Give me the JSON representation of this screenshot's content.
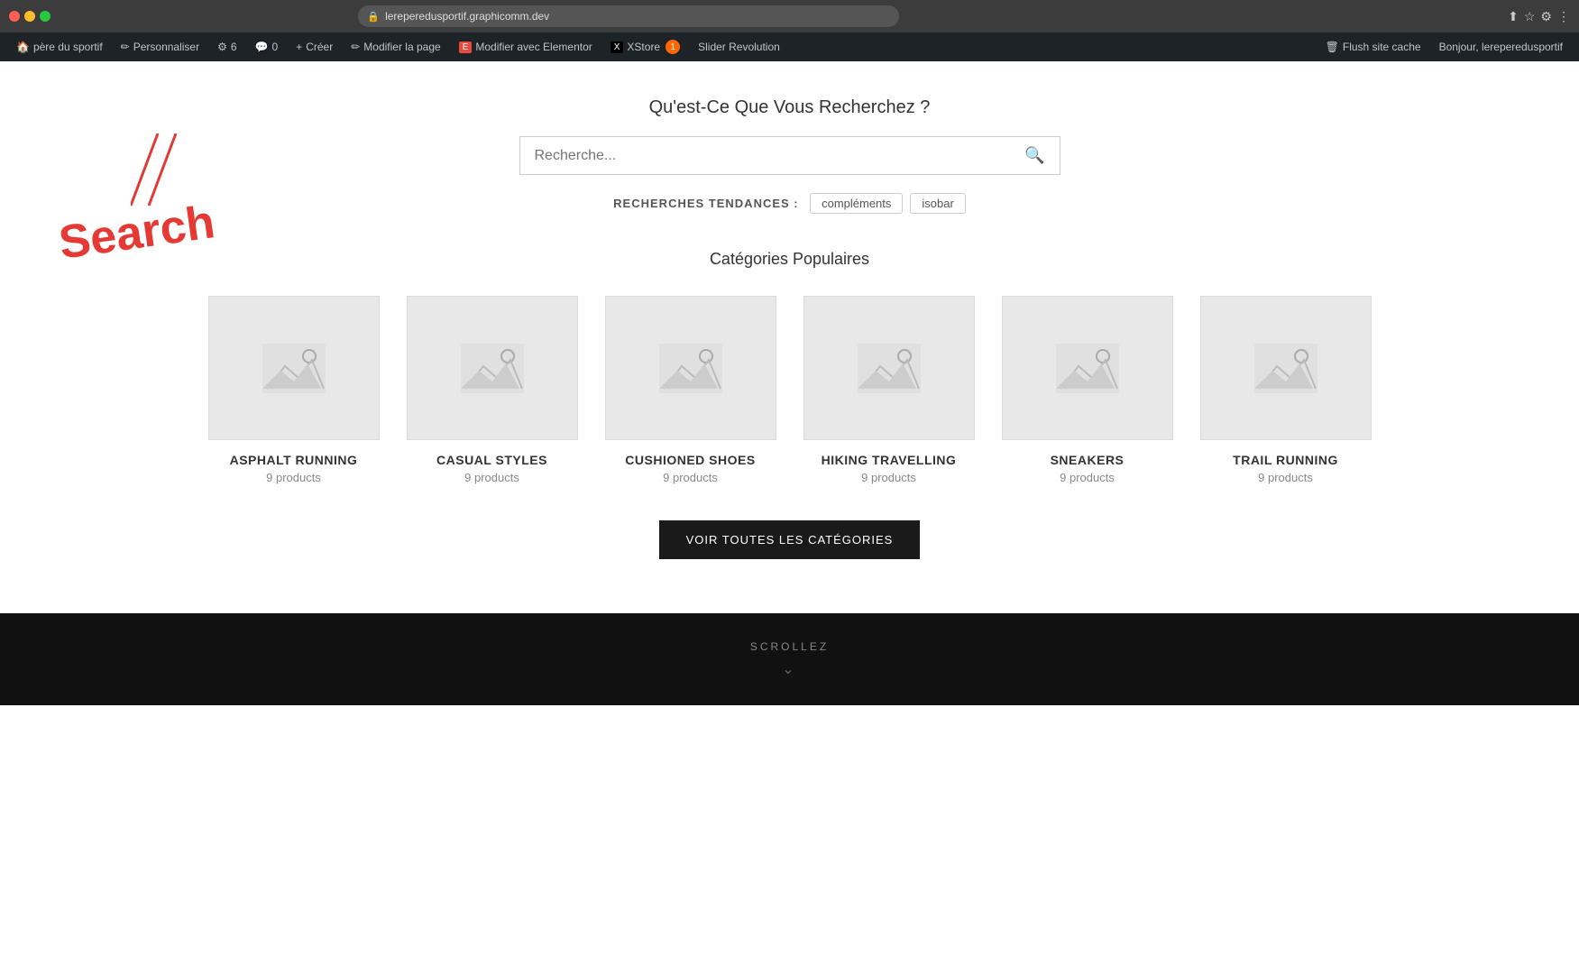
{
  "browser": {
    "url": "lereperedusportif.graphicomm.dev",
    "lock_symbol": "🔒"
  },
  "admin_bar": {
    "site_name": "père du sportif",
    "items": [
      {
        "label": "Personnaliser",
        "icon": "✏️"
      },
      {
        "label": "6",
        "icon": "⚙️"
      },
      {
        "label": "0",
        "icon": "💬"
      },
      {
        "label": "Créer",
        "icon": "+"
      },
      {
        "label": "Modifier la page",
        "icon": "✏️"
      },
      {
        "label": "Modifier avec Elementor",
        "icon": "E"
      },
      {
        "label": "XStore",
        "icon": "X",
        "badge": "1"
      },
      {
        "label": "Slider Revolution",
        "icon": ""
      }
    ],
    "flush_label": "Flush site cache",
    "hello_label": "Bonjour, lereperedusportif"
  },
  "search": {
    "question": "Qu'est-Ce Que Vous Recherchez ?",
    "placeholder": "Recherche...",
    "trending_label": "RECHERCHES TENDANCES :",
    "trending_tags": [
      "compléments",
      "isobar"
    ]
  },
  "categories": {
    "title": "Catégories Populaires",
    "items": [
      {
        "name": "ASPHALT RUNNING",
        "count": "9 products"
      },
      {
        "name": "CASUAL STYLES",
        "count": "9 products"
      },
      {
        "name": "CUSHIONED SHOES",
        "count": "9 products"
      },
      {
        "name": "HIKING TRAVELLING",
        "count": "9 products"
      },
      {
        "name": "SNEAKERS",
        "count": "9 products"
      },
      {
        "name": "TRAIL RUNNING",
        "count": "9 products"
      }
    ],
    "view_all_label": "Voir Toutes Les Catégories"
  },
  "scroll": {
    "label": "SCROLLEZ",
    "arrow": "⌄"
  },
  "annotation": {
    "search_text": "Search"
  }
}
